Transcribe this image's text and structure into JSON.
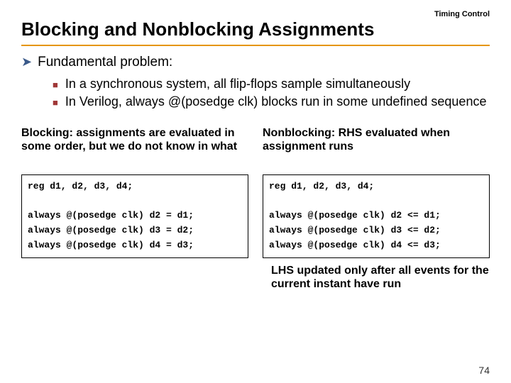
{
  "header": {
    "section_label": "Timing Control",
    "title": "Blocking and Nonblocking Assignments"
  },
  "main_point": {
    "text": "Fundamental problem:"
  },
  "sub_points": [
    "In a synchronous system, all flip-flops sample simultaneously",
    "In Verilog, always @(posedge clk) blocks run in some undefined sequence"
  ],
  "left": {
    "desc": "Blocking: assignments are evaluated in some order, but we do not know in what",
    "code": "reg d1, d2, d3, d4;\n\nalways @(posedge clk) d2 = d1;\nalways @(posedge clk) d3 = d2;\nalways @(posedge clk) d4 = d3;"
  },
  "right": {
    "desc": "Nonblocking: RHS evaluated when assignment runs",
    "code": "reg d1, d2, d3, d4;\n\nalways @(posedge clk) d2 <= d1;\nalways @(posedge clk) d3 <= d2;\nalways @(posedge clk) d4 <= d3;",
    "footnote": "LHS updated only after all events for the current instant have run"
  },
  "page_number": "74"
}
